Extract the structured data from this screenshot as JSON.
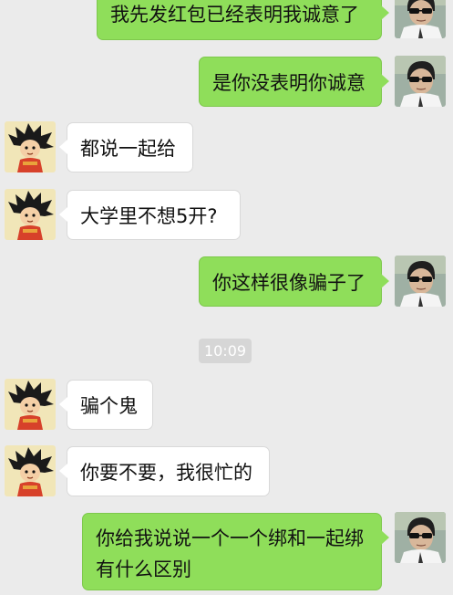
{
  "chat": {
    "timestamp": "10:09",
    "messages": [
      {
        "side": "out",
        "text": "我先发红包已经表明我诚意了"
      },
      {
        "side": "out",
        "text": "是你没表明你诚意"
      },
      {
        "side": "in",
        "text": "都说一起给"
      },
      {
        "side": "in",
        "text": "大学里不想5开?"
      },
      {
        "side": "out",
        "text": "你这样很像骗子了"
      },
      {
        "side": "in",
        "text": "骗个鬼"
      },
      {
        "side": "in",
        "text": "你要不要，我很忙的"
      },
      {
        "side": "out",
        "text": "你给我说说一个一个绑和一起绑有什么区别"
      }
    ]
  },
  "colors": {
    "background": "#ebebeb",
    "outgoing_bubble": "#8fde5a",
    "incoming_bubble": "#ffffff",
    "timestamp_bg": "#d6d6d6"
  },
  "icons": {
    "incoming_avatar": "cartoon-boy-avatar-icon",
    "outgoing_avatar": "man-with-sunglasses-avatar-icon"
  }
}
